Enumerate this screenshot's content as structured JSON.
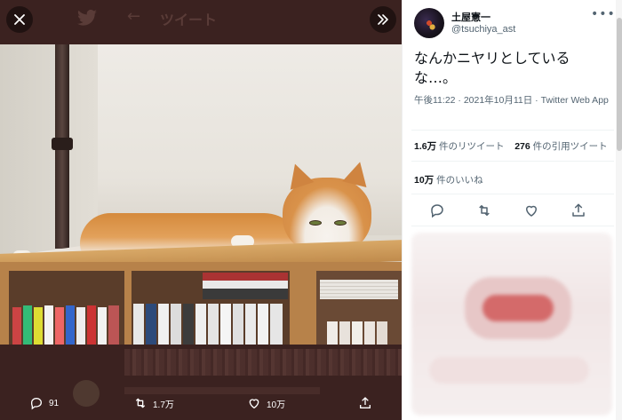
{
  "viewer": {
    "bg_title": "ツイート",
    "actions": [
      {
        "icon": "reply-icon",
        "count": "91"
      },
      {
        "icon": "retweet-icon",
        "count": "1.7万"
      },
      {
        "icon": "like-icon",
        "count": "10万"
      },
      {
        "icon": "share-icon",
        "count": ""
      }
    ]
  },
  "tweet": {
    "display_name": "土屋憲一",
    "handle": "@tsuchiya_ast",
    "text_line1": "なんかニヤリとしている",
    "text_line2": "な…。",
    "time": "午後11:22 · 2021年10月11日 · ",
    "via": "Twitter Web App",
    "retweets_count": "1.6万",
    "retweets_label": "件のリツイート",
    "quotes_count": "276",
    "quotes_label": "件の引用ツイート",
    "likes_count": "10万",
    "likes_label": "件のいいね"
  },
  "colors": {
    "viewer_bg": "#3b2220",
    "text_primary": "#0f1419",
    "text_secondary": "#536471"
  }
}
